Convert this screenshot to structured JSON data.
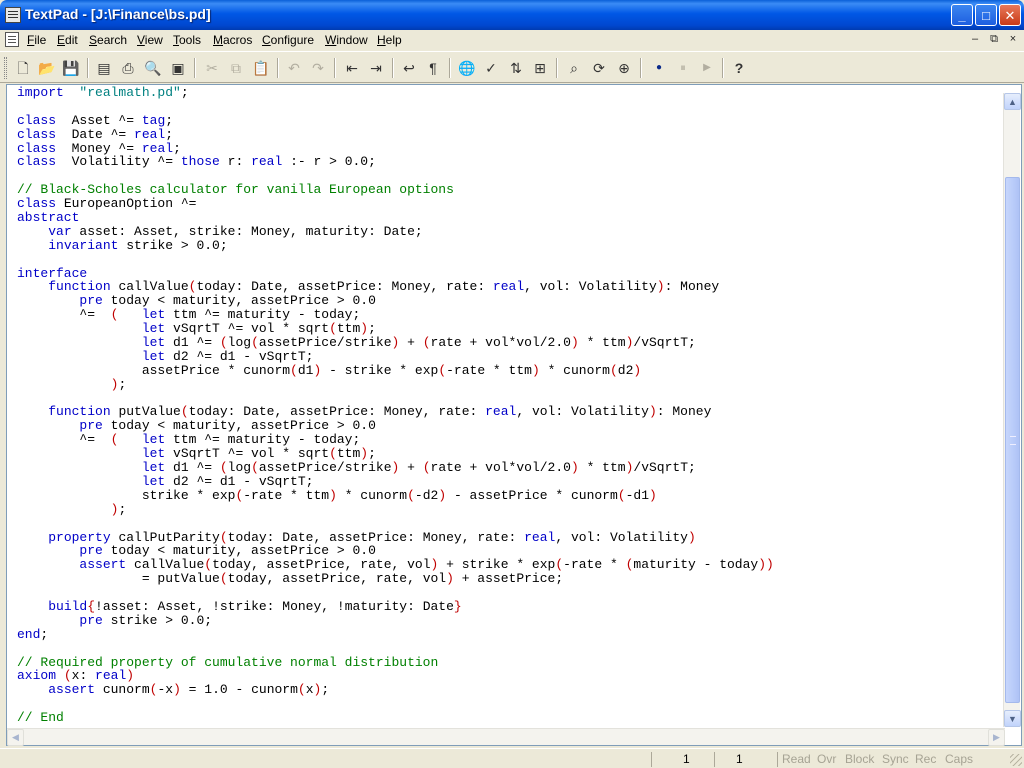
{
  "window": {
    "title": "TextPad - [J:\\Finance\\bs.pd]",
    "controls": {
      "minimize": "_",
      "maximize": "□",
      "close": "✕"
    }
  },
  "menu": {
    "items": [
      "File",
      "Edit",
      "Search",
      "View",
      "Tools",
      "Macros",
      "Configure",
      "Window",
      "Help"
    ],
    "mdi_controls": {
      "minimize": "–",
      "restore": "⧉",
      "close": "×"
    }
  },
  "toolbar": {
    "buttons": [
      {
        "icon": "new-file-icon",
        "glyph": "🗋"
      },
      {
        "icon": "open-folder-icon",
        "glyph": "📂"
      },
      {
        "icon": "save-icon",
        "glyph": "💾"
      },
      {
        "icon": "save-all-icon",
        "glyph": "▤"
      },
      {
        "icon": "print-icon",
        "glyph": "⎙"
      },
      {
        "icon": "print-preview-icon",
        "glyph": "🔍"
      },
      {
        "icon": "manage-files-icon",
        "glyph": "▣"
      },
      {
        "icon": "cut-icon",
        "glyph": "✂"
      },
      {
        "icon": "copy-icon",
        "glyph": "⧉"
      },
      {
        "icon": "paste-icon",
        "glyph": "📋"
      },
      {
        "icon": "undo-icon",
        "glyph": "↶"
      },
      {
        "icon": "redo-icon",
        "glyph": "↷"
      },
      {
        "icon": "decrease-indent-icon",
        "glyph": "⇤"
      },
      {
        "icon": "increase-indent-icon",
        "glyph": "⇥"
      },
      {
        "icon": "word-wrap-icon",
        "glyph": "↩"
      },
      {
        "icon": "show-paragraph-icon",
        "glyph": "¶"
      },
      {
        "icon": "web-icon",
        "glyph": "🌐"
      },
      {
        "icon": "spelling-icon",
        "glyph": "✓"
      },
      {
        "icon": "sort-icon",
        "glyph": "⇅"
      },
      {
        "icon": "compare-icon",
        "glyph": "⊞"
      },
      {
        "icon": "find-icon",
        "glyph": "⌕"
      },
      {
        "icon": "find-next-icon",
        "glyph": "⟳"
      },
      {
        "icon": "find-in-files-icon",
        "glyph": "⊕"
      },
      {
        "icon": "record-macro-icon",
        "glyph": "●"
      },
      {
        "icon": "pause-macro-icon",
        "glyph": "⏸"
      },
      {
        "icon": "play-macro-icon",
        "glyph": "▶"
      },
      {
        "icon": "context-help-icon",
        "glyph": "?"
      }
    ]
  },
  "editor": {
    "lines": [
      [
        [
          "kw",
          "import"
        ],
        [
          "",
          "  "
        ],
        [
          "str",
          "\"realmath.pd\""
        ],
        [
          "",
          ";"
        ]
      ],
      [],
      [
        [
          "kw",
          "class"
        ],
        [
          "",
          "  Asset ^= "
        ],
        [
          "kw",
          "tag"
        ],
        [
          "",
          ";"
        ]
      ],
      [
        [
          "kw",
          "class"
        ],
        [
          "",
          "  Date ^= "
        ],
        [
          "kw",
          "real"
        ],
        [
          "",
          ";"
        ]
      ],
      [
        [
          "kw",
          "class"
        ],
        [
          "",
          "  Money ^= "
        ],
        [
          "kw",
          "real"
        ],
        [
          "",
          ";"
        ]
      ],
      [
        [
          "kw",
          "class"
        ],
        [
          "",
          "  Volatility ^= "
        ],
        [
          "kw",
          "those"
        ],
        [
          "",
          " r: "
        ],
        [
          "kw",
          "real"
        ],
        [
          "",
          " :- r > 0.0;"
        ]
      ],
      [],
      [
        [
          "cm",
          "// Black-Scholes calculator for vanilla European options"
        ]
      ],
      [
        [
          "kw",
          "class"
        ],
        [
          "",
          " EuropeanOption ^="
        ]
      ],
      [
        [
          "kw",
          "abstract"
        ]
      ],
      [
        [
          "",
          "    "
        ],
        [
          "kw",
          "var"
        ],
        [
          "",
          " asset: Asset, strike: Money, maturity: Date;"
        ]
      ],
      [
        [
          "",
          "    "
        ],
        [
          "kw",
          "invariant"
        ],
        [
          "",
          " strike > 0.0;"
        ]
      ],
      [],
      [
        [
          "kw",
          "interface"
        ]
      ],
      [
        [
          "",
          "    "
        ],
        [
          "kw",
          "function"
        ],
        [
          "",
          " callValue"
        ],
        [
          "pn",
          "("
        ],
        [
          "",
          "today: Date, assetPrice: Money, rate: "
        ],
        [
          "kw",
          "real"
        ],
        [
          "",
          ", vol: Volatility"
        ],
        [
          "pn",
          ")"
        ],
        [
          "",
          ": Money"
        ]
      ],
      [
        [
          "",
          "        "
        ],
        [
          "kw",
          "pre"
        ],
        [
          "",
          " today < maturity, assetPrice > 0.0"
        ]
      ],
      [
        [
          "",
          "        ^=  "
        ],
        [
          "pn",
          "("
        ],
        [
          "",
          "   "
        ],
        [
          "kw",
          "let"
        ],
        [
          "",
          " ttm ^= maturity - today;"
        ]
      ],
      [
        [
          "",
          "                "
        ],
        [
          "kw",
          "let"
        ],
        [
          "",
          " vSqrtT ^= vol * sqrt"
        ],
        [
          "pn",
          "("
        ],
        [
          "",
          "ttm"
        ],
        [
          "pn",
          ")"
        ],
        [
          "",
          ";"
        ]
      ],
      [
        [
          "",
          "                "
        ],
        [
          "kw",
          "let"
        ],
        [
          "",
          " d1 ^= "
        ],
        [
          "pn",
          "("
        ],
        [
          "",
          "log"
        ],
        [
          "pn",
          "("
        ],
        [
          "",
          "assetPrice/strike"
        ],
        [
          "pn",
          ")"
        ],
        [
          "",
          " + "
        ],
        [
          "pn",
          "("
        ],
        [
          "",
          "rate + vol*vol/2.0"
        ],
        [
          "pn",
          ")"
        ],
        [
          "",
          " * ttm"
        ],
        [
          "pn",
          ")"
        ],
        [
          "",
          "/vSqrtT;"
        ]
      ],
      [
        [
          "",
          "                "
        ],
        [
          "kw",
          "let"
        ],
        [
          "",
          " d2 ^= d1 - vSqrtT;"
        ]
      ],
      [
        [
          "",
          "                assetPrice * cunorm"
        ],
        [
          "pn",
          "("
        ],
        [
          "",
          "d1"
        ],
        [
          "pn",
          ")"
        ],
        [
          "",
          " - strike * exp"
        ],
        [
          "pn",
          "("
        ],
        [
          "",
          "-rate * ttm"
        ],
        [
          "pn",
          ")"
        ],
        [
          "",
          " * cunorm"
        ],
        [
          "pn",
          "("
        ],
        [
          "",
          "d2"
        ],
        [
          "pn",
          ")"
        ]
      ],
      [
        [
          "",
          "            "
        ],
        [
          "pn",
          ")"
        ],
        [
          "",
          ";"
        ]
      ],
      [],
      [
        [
          "",
          "    "
        ],
        [
          "kw",
          "function"
        ],
        [
          "",
          " putValue"
        ],
        [
          "pn",
          "("
        ],
        [
          "",
          "today: Date, assetPrice: Money, rate: "
        ],
        [
          "kw",
          "real"
        ],
        [
          "",
          ", vol: Volatility"
        ],
        [
          "pn",
          ")"
        ],
        [
          "",
          ": Money"
        ]
      ],
      [
        [
          "",
          "        "
        ],
        [
          "kw",
          "pre"
        ],
        [
          "",
          " today < maturity, assetPrice > 0.0"
        ]
      ],
      [
        [
          "",
          "        ^=  "
        ],
        [
          "pn",
          "("
        ],
        [
          "",
          "   "
        ],
        [
          "kw",
          "let"
        ],
        [
          "",
          " ttm ^= maturity - today;"
        ]
      ],
      [
        [
          "",
          "                "
        ],
        [
          "kw",
          "let"
        ],
        [
          "",
          " vSqrtT ^= vol * sqrt"
        ],
        [
          "pn",
          "("
        ],
        [
          "",
          "ttm"
        ],
        [
          "pn",
          ")"
        ],
        [
          "",
          ";"
        ]
      ],
      [
        [
          "",
          "                "
        ],
        [
          "kw",
          "let"
        ],
        [
          "",
          " d1 ^= "
        ],
        [
          "pn",
          "("
        ],
        [
          "",
          "log"
        ],
        [
          "pn",
          "("
        ],
        [
          "",
          "assetPrice/strike"
        ],
        [
          "pn",
          ")"
        ],
        [
          "",
          " + "
        ],
        [
          "pn",
          "("
        ],
        [
          "",
          "rate + vol*vol/2.0"
        ],
        [
          "pn",
          ")"
        ],
        [
          "",
          " * ttm"
        ],
        [
          "pn",
          ")"
        ],
        [
          "",
          "/vSqrtT;"
        ]
      ],
      [
        [
          "",
          "                "
        ],
        [
          "kw",
          "let"
        ],
        [
          "",
          " d2 ^= d1 - vSqrtT;"
        ]
      ],
      [
        [
          "",
          "                strike * exp"
        ],
        [
          "pn",
          "("
        ],
        [
          "",
          "-rate * ttm"
        ],
        [
          "pn",
          ")"
        ],
        [
          "",
          " * cunorm"
        ],
        [
          "pn",
          "("
        ],
        [
          "",
          "-d2"
        ],
        [
          "pn",
          ")"
        ],
        [
          "",
          " - assetPrice * cunorm"
        ],
        [
          "pn",
          "("
        ],
        [
          "",
          "-d1"
        ],
        [
          "pn",
          ")"
        ]
      ],
      [
        [
          "",
          "            "
        ],
        [
          "pn",
          ")"
        ],
        [
          "",
          ";"
        ]
      ],
      [],
      [
        [
          "",
          "    "
        ],
        [
          "kw",
          "property"
        ],
        [
          "",
          " callPutParity"
        ],
        [
          "pn",
          "("
        ],
        [
          "",
          "today: Date, assetPrice: Money, rate: "
        ],
        [
          "kw",
          "real"
        ],
        [
          "",
          ", vol: Volatility"
        ],
        [
          "pn",
          ")"
        ]
      ],
      [
        [
          "",
          "        "
        ],
        [
          "kw",
          "pre"
        ],
        [
          "",
          " today < maturity, assetPrice > 0.0"
        ]
      ],
      [
        [
          "",
          "        "
        ],
        [
          "kw",
          "assert"
        ],
        [
          "",
          " callValue"
        ],
        [
          "pn",
          "("
        ],
        [
          "",
          "today, assetPrice, rate, vol"
        ],
        [
          "pn",
          ")"
        ],
        [
          "",
          " + strike * exp"
        ],
        [
          "pn",
          "("
        ],
        [
          "",
          "-rate * "
        ],
        [
          "pn",
          "("
        ],
        [
          "",
          "maturity - today"
        ],
        [
          "pn",
          "))"
        ]
      ],
      [
        [
          "",
          "                = putValue"
        ],
        [
          "pn",
          "("
        ],
        [
          "",
          "today, assetPrice, rate, vol"
        ],
        [
          "pn",
          ")"
        ],
        [
          "",
          " + assetPrice;"
        ]
      ],
      [],
      [
        [
          "",
          "    "
        ],
        [
          "kw",
          "build"
        ],
        [
          "pn",
          "{"
        ],
        [
          "",
          "!asset: Asset, !strike: Money, !maturity: Date"
        ],
        [
          "pn",
          "}"
        ]
      ],
      [
        [
          "",
          "        "
        ],
        [
          "kw",
          "pre"
        ],
        [
          "",
          " strike > 0.0;"
        ]
      ],
      [
        [
          "kw",
          "end"
        ],
        [
          "",
          ";"
        ]
      ],
      [],
      [
        [
          "cm",
          "// Required property of cumulative normal distribution"
        ]
      ],
      [
        [
          "kw",
          "axiom"
        ],
        [
          "",
          " "
        ],
        [
          "pn",
          "("
        ],
        [
          "",
          "x: "
        ],
        [
          "kw",
          "real"
        ],
        [
          "pn",
          ")"
        ]
      ],
      [
        [
          "",
          "    "
        ],
        [
          "kw",
          "assert"
        ],
        [
          "",
          " cunorm"
        ],
        [
          "pn",
          "("
        ],
        [
          "",
          "-x"
        ],
        [
          "pn",
          ")"
        ],
        [
          "",
          " = 1.0 - cunorm"
        ],
        [
          "pn",
          "("
        ],
        [
          "",
          "x"
        ],
        [
          "pn",
          ")"
        ],
        [
          "",
          ";"
        ]
      ],
      [],
      [
        [
          "cm",
          "// End"
        ]
      ]
    ]
  },
  "scrollbars": {
    "up": "▲",
    "down": "▼",
    "left": "◀",
    "right": "▶"
  },
  "statusbar": {
    "line": "1",
    "column": "1",
    "indicators": [
      "Read",
      "Ovr",
      "Block",
      "Sync",
      "Rec",
      "Caps"
    ]
  }
}
